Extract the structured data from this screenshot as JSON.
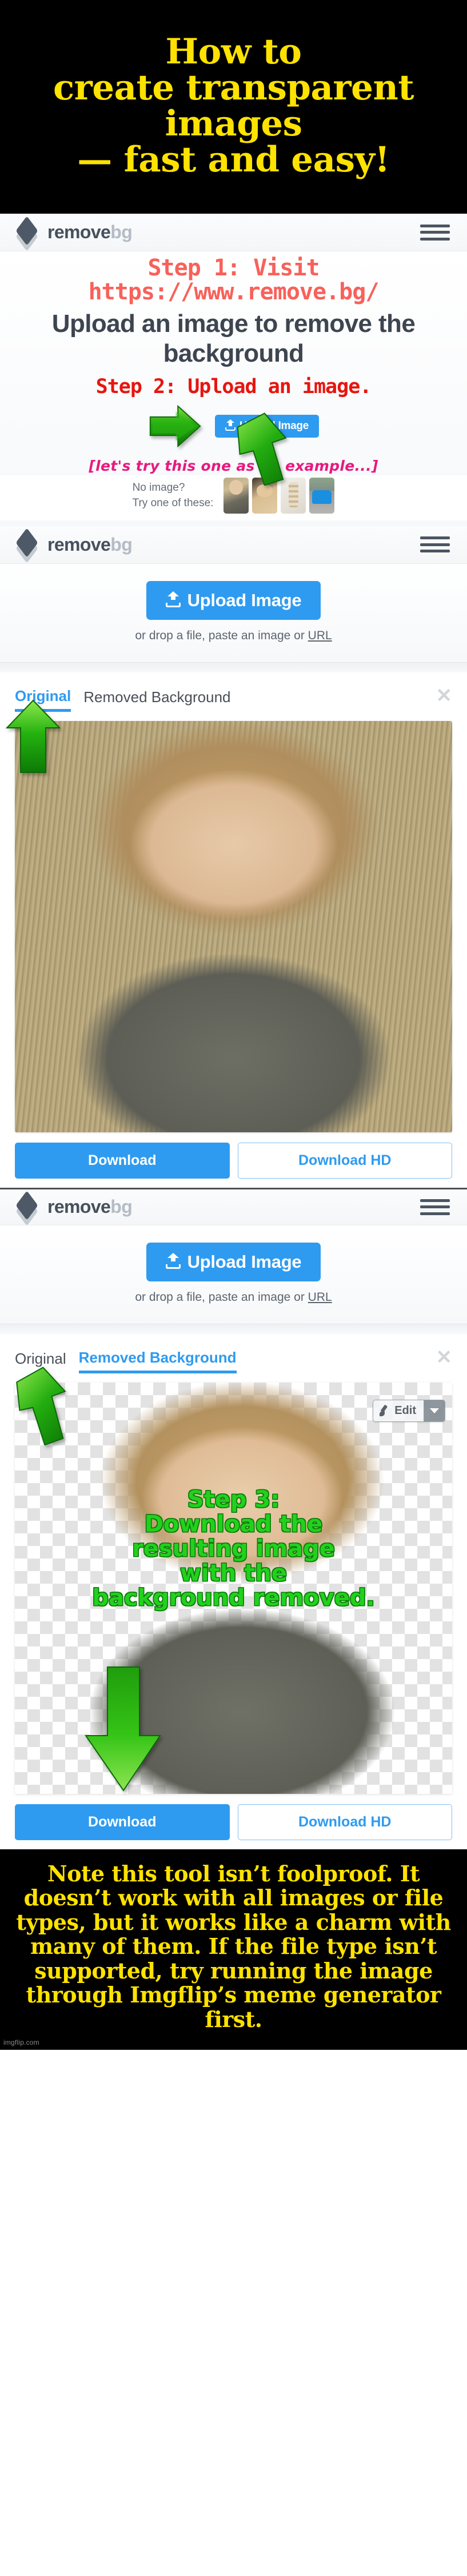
{
  "meme": {
    "top_title_lines": [
      "How to",
      "create transparent",
      "images",
      "— fast and easy!"
    ],
    "bottom_note": "Note this tool isn’t foolproof. It doesn’t work with all images or file types, but it works like a charm with many of them. If the file type isn’t supported, try running the image through Imgflip’s meme generator first.",
    "watermark": "imgflip.com",
    "colors": {
      "banner_bg": "#000000",
      "banner_text": "#ffe200"
    }
  },
  "captions": {
    "step1": "Step 1: Visit\nhttps://www.remove.bg/",
    "step1_color": "#f8615a",
    "step2": "Step 2: Upload an image.",
    "step2_color": "#e8150f",
    "example_hint": "[let's try this one as an example...]",
    "example_hint_color": "#e8197f",
    "step3": "Step 3:\nDownload the\nresulting image\nwith the\nbackground removed.",
    "step3_color": "#22d11d"
  },
  "site": {
    "brand_primary": "remove",
    "brand_secondary": "bg",
    "accent_color": "#2e9bf0",
    "menu_label": "menu"
  },
  "hero": {
    "title": "Upload an image to remove the background",
    "upload_label": "Upload Image",
    "drop_hint_prefix": "or drop a file, paste an image or ",
    "drop_hint_link": "URL"
  },
  "examples": {
    "label_line1": "No image?",
    "label_line2": "Try one of these:",
    "thumbs": [
      {
        "name": "woman-thumb",
        "alt": "woman in field"
      },
      {
        "name": "dog-thumb",
        "alt": "golden retriever"
      },
      {
        "name": "food-thumb",
        "alt": "dessert"
      },
      {
        "name": "car-thumb",
        "alt": "blue car"
      }
    ]
  },
  "result_original": {
    "tab_original": "Original",
    "tab_removed": "Removed Background",
    "active_tab": "Original",
    "close_label": "✕",
    "download_label": "Download",
    "download_hd_label": "Download HD",
    "photo_alt": "Smiling blonde woman in a grassy field"
  },
  "result_removed": {
    "tab_original": "Original",
    "tab_removed": "Removed Background",
    "active_tab": "Removed Background",
    "close_label": "✕",
    "edit_label": "Edit",
    "download_label": "Download",
    "download_hd_label": "Download HD",
    "photo_alt": "Smiling blonde woman on transparent checkerboard background"
  },
  "icons": {
    "hamburger": "hamburger-menu-icon",
    "upload": "upload-arrow-icon",
    "close": "close-icon",
    "brush": "brush-icon",
    "caret": "chevron-down-icon",
    "arrow_right": "green-arrow-right-icon",
    "arrow_up": "green-arrow-up-icon",
    "arrow_down": "green-arrow-down-icon"
  }
}
